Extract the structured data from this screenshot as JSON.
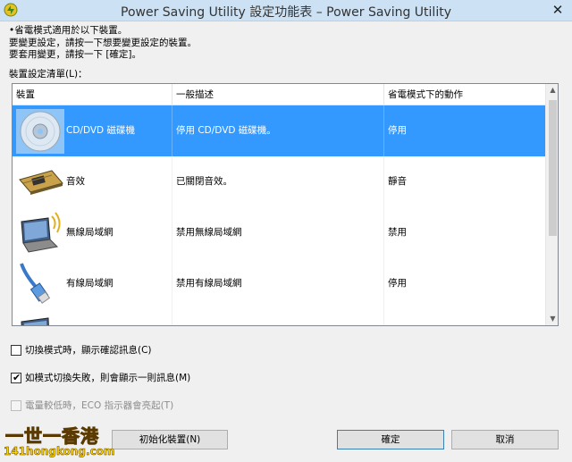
{
  "window": {
    "title": "Power Saving Utility 設定功能表 – Power Saving Utility",
    "close_glyph": "✕"
  },
  "intro": {
    "line1": "•省電模式適用於以下裝置。",
    "line2": "要變更設定，請按一下想要變更設定的裝置。",
    "line3": "要套用變更，請按一下 [確定]。"
  },
  "list_label": "裝置設定清單(L)：",
  "columns": {
    "device": "裝置",
    "description": "一般描述",
    "action": "省電模式下的動作"
  },
  "rows": [
    {
      "icon": "cd-dvd-icon",
      "device": "CD/DVD 磁碟機",
      "description": "停用 CD/DVD 磁碟機。",
      "action": "停用",
      "selected": true
    },
    {
      "icon": "sound-card-icon",
      "device": "音效",
      "description": "已關閉音效。",
      "action": "靜音",
      "selected": false
    },
    {
      "icon": "wireless-laptop-icon",
      "device": "無線局域網",
      "description": "禁用無線局域網",
      "action": "禁用",
      "selected": false
    },
    {
      "icon": "network-cable-icon",
      "device": "有線局域網",
      "description": "禁用有線局域網",
      "action": "停用",
      "selected": false
    },
    {
      "icon": "laptop-icon",
      "device": "",
      "description": "",
      "action": "",
      "selected": false
    }
  ],
  "options": {
    "confirm_on_switch": {
      "label": "切換模式時，顯示確認訊息(C)",
      "checked": false,
      "enabled": true
    },
    "show_on_fail": {
      "label": "如模式切換失敗，則會顯示一則訊息(M)",
      "checked": true,
      "enabled": true
    },
    "eco_led": {
      "label": "電量較低時，ECO 指示器會亮起(T)",
      "checked": false,
      "enabled": false
    }
  },
  "buttons": {
    "init": "初始化裝置(N)",
    "ok": "確定",
    "cancel": "取消"
  },
  "watermark": {
    "line1": "一世一香港",
    "line2": "141hongkong.com"
  },
  "colors": {
    "selection": "#3399ff",
    "titlebar": "#cce1f3"
  }
}
